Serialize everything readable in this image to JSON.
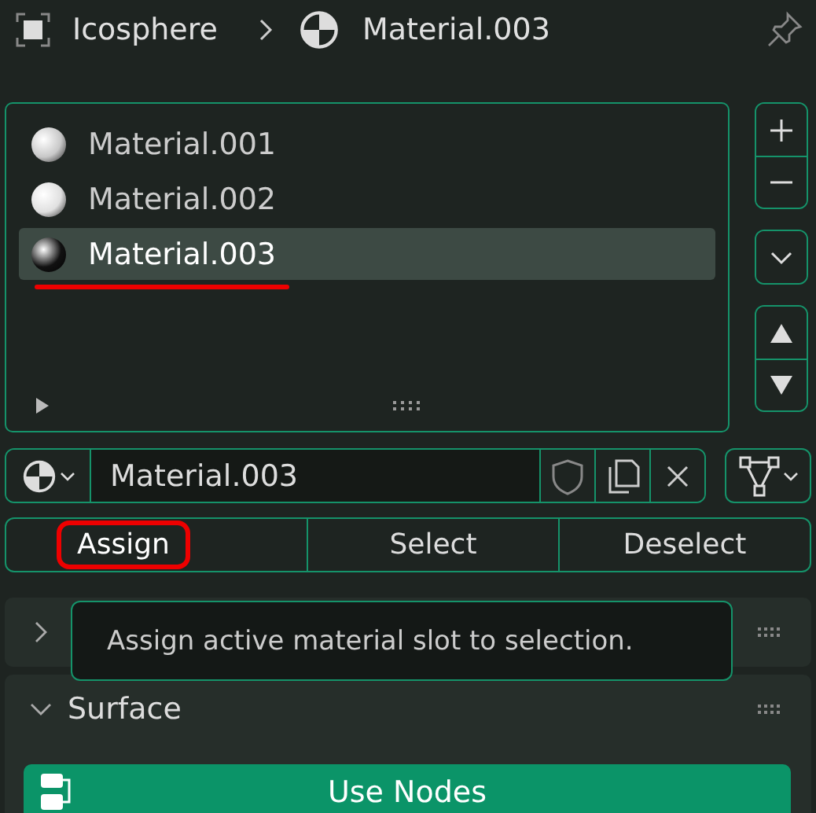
{
  "header": {
    "object": "Icosphere",
    "material": "Material.003"
  },
  "material_slots": [
    {
      "name": "Material.001",
      "selected": false,
      "underlined": false,
      "color": "#c8c8c8"
    },
    {
      "name": "Material.002",
      "selected": false,
      "underlined": false,
      "color": "#e0e0e0"
    },
    {
      "name": "Material.003",
      "selected": true,
      "underlined": true,
      "color": "#111111"
    }
  ],
  "material_field": {
    "value": "Material.003"
  },
  "actions": [
    {
      "label": "Assign",
      "highlighted": true
    },
    {
      "label": "Select",
      "highlighted": false
    },
    {
      "label": "Deselect",
      "highlighted": false
    }
  ],
  "tooltip": {
    "text": "Assign active material slot to selection."
  },
  "panels": [
    {
      "expanded": false
    },
    {
      "title": "Surface",
      "expanded": true,
      "button": "Use Nodes"
    }
  ]
}
